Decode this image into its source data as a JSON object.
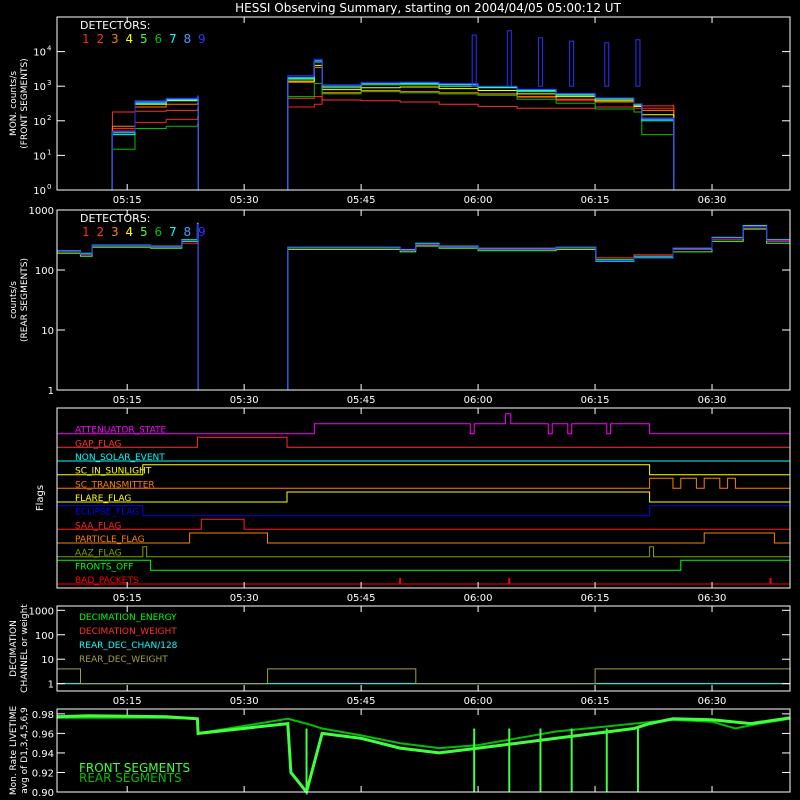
{
  "title": "HESSI Observing Summary, starting on 2004/04/05 05:00:12 UT",
  "colors": {
    "background": "#000000",
    "axes": "#ffffff",
    "det": [
      "#ff2020",
      "#ff3030",
      "#ff7f00",
      "#ffff00",
      "#40ff40",
      "#00c000",
      "#00ffff",
      "#40a0ff",
      "#3030ff"
    ],
    "flags": {
      "attenuator": "#ff00ff",
      "gap": "#ff3030",
      "non_solar": "#00ffff",
      "in_sunlight": "#ffff00",
      "transmitter": "#ff7f00",
      "flare": "#ffff00",
      "eclipse": "#0000ff",
      "saa": "#ff2020",
      "particle": "#ff7f00",
      "aaz": "#80a000",
      "fronts_off": "#00ff00",
      "bad_packets": "#ff0000"
    },
    "dec": [
      "#00ff00",
      "#ff3030",
      "#00ffff",
      "#a0a040"
    ],
    "livetime_front": "#40ff40",
    "livetime_rear": "#00c000"
  },
  "time_axis": {
    "start_min": 6,
    "end_min": 100,
    "ticks": [
      {
        "t": 15,
        "label": "05:15"
      },
      {
        "t": 30,
        "label": "05:30"
      },
      {
        "t": 45,
        "label": "05:45"
      },
      {
        "t": 60,
        "label": "06:00"
      },
      {
        "t": 75,
        "label": "06:15"
      },
      {
        "t": 90,
        "label": "06:30"
      }
    ]
  },
  "chart_data": [
    {
      "type": "line",
      "panel": "front",
      "ylabel": "MON. counts/s (FRONT SEGMENTS)",
      "ylabel_lines": [
        "MON. counts/s",
        "(FRONT SEGMENTS)"
      ],
      "y_scale": "log",
      "ylim": [
        1,
        100000
      ],
      "yticks": [
        {
          "v": 1,
          "base": "10",
          "exp": "0"
        },
        {
          "v": 10,
          "base": "10",
          "exp": "1"
        },
        {
          "v": 100,
          "base": "10",
          "exp": "2"
        },
        {
          "v": 1000,
          "base": "10",
          "exp": "3"
        },
        {
          "v": 10000,
          "base": "10",
          "exp": "4"
        }
      ],
      "legend_title": "DETECTORS:",
      "legend_items": [
        "1",
        "2",
        "3",
        "4",
        "5",
        "6",
        "7",
        "8",
        "9"
      ],
      "x_minutes": [
        6,
        13,
        13.1,
        16,
        20,
        24,
        24.1,
        35.5,
        35.6,
        39,
        40,
        45,
        50,
        55,
        60,
        65,
        70,
        75,
        80,
        81,
        85,
        85.1,
        100
      ],
      "series": [
        {
          "detector": "1",
          "values": [
            1,
            1,
            60,
            90,
            110,
            130,
            1,
            1,
            250,
            300,
            650,
            700,
            650,
            600,
            550,
            480,
            380,
            350,
            230,
            230,
            230,
            1,
            1
          ]
        },
        {
          "detector": "2",
          "values": [
            1,
            1,
            180,
            190,
            200,
            220,
            1,
            1,
            450,
            500,
            400,
            380,
            350,
            300,
            260,
            230,
            230,
            250,
            260,
            270,
            280,
            1,
            1
          ]
        },
        {
          "detector": "3",
          "values": [
            1,
            1,
            70,
            250,
            300,
            320,
            1,
            1,
            1300,
            3500,
            650,
            750,
            700,
            650,
            600,
            500,
            420,
            350,
            260,
            200,
            200,
            1,
            1
          ]
        },
        {
          "detector": "4",
          "values": [
            1,
            1,
            50,
            300,
            380,
            420,
            1,
            1,
            1400,
            4000,
            800,
            900,
            950,
            850,
            750,
            600,
            500,
            380,
            260,
            150,
            150,
            1,
            1
          ]
        },
        {
          "detector": "5",
          "values": [
            1,
            1,
            45,
            350,
            400,
            450,
            1,
            1,
            1600,
            5000,
            900,
            1100,
            1100,
            1000,
            900,
            700,
            550,
            420,
            280,
            120,
            120,
            1,
            1
          ]
        },
        {
          "detector": "6",
          "values": [
            1,
            1,
            15,
            60,
            70,
            80,
            1,
            1,
            500,
            1200,
            600,
            700,
            650,
            600,
            550,
            420,
            320,
            220,
            180,
            40,
            40,
            1,
            1
          ]
        },
        {
          "detector": "7",
          "values": [
            1,
            1,
            40,
            320,
            400,
            500,
            1,
            1,
            1700,
            5000,
            1000,
            1200,
            1200,
            1100,
            950,
            750,
            580,
            440,
            300,
            100,
            100,
            1,
            1
          ]
        },
        {
          "detector": "8",
          "values": [
            1,
            1,
            45,
            350,
            420,
            480,
            1,
            1,
            1800,
            5500,
            1000,
            1200,
            1250,
            1150,
            980,
            800,
            600,
            450,
            300,
            110,
            110,
            1,
            1
          ]
        },
        {
          "detector": "9",
          "values": [
            1,
            1,
            50,
            380,
            450,
            520,
            1,
            1,
            2000,
            6000,
            1100,
            1300,
            1300,
            1200,
            1000,
            820,
            620,
            460,
            310,
            120,
            120,
            1,
            1
          ]
        }
      ],
      "spikes": [
        {
          "t": 59.5,
          "value": 30000
        },
        {
          "t": 64,
          "value": 40000
        },
        {
          "t": 68,
          "value": 25000
        },
        {
          "t": 72,
          "value": 20000
        },
        {
          "t": 76.5,
          "value": 18000
        },
        {
          "t": 80.5,
          "value": 22000
        }
      ]
    },
    {
      "type": "line",
      "panel": "rear",
      "ylabel": "counts/s (REAR SEGMENTS)",
      "ylabel_lines": [
        "counts/s",
        "(REAR SEGMENTS)"
      ],
      "y_scale": "log",
      "ylim": [
        1,
        1000
      ],
      "yticks": [
        {
          "v": 1,
          "label": "1"
        },
        {
          "v": 10,
          "label": "10"
        },
        {
          "v": 100,
          "label": "100"
        },
        {
          "v": 1000,
          "label": "1000"
        }
      ],
      "legend_title": "DETECTORS:",
      "legend_items": [
        "1",
        "2",
        "3",
        "4",
        "5",
        "6",
        "7",
        "8",
        "9"
      ],
      "x_minutes": [
        6,
        9,
        10.5,
        18,
        22,
        24,
        24.1,
        35.5,
        35.6,
        45,
        50,
        52,
        55,
        60,
        70,
        75,
        75.1,
        80,
        85,
        90,
        94,
        97,
        100
      ],
      "series": [
        {
          "detector": "1",
          "values": [
            200,
            180,
            250,
            240,
            280,
            400,
            1,
            1,
            230,
            230,
            210,
            260,
            240,
            220,
            230,
            230,
            160,
            180,
            220,
            320,
            500,
            300,
            200
          ]
        },
        {
          "detector": "5",
          "values": [
            190,
            170,
            240,
            230,
            300,
            500,
            1,
            1,
            220,
            220,
            200,
            250,
            230,
            210,
            220,
            220,
            150,
            170,
            200,
            300,
            480,
            280,
            190
          ]
        },
        {
          "detector": "7",
          "values": [
            210,
            190,
            260,
            250,
            320,
            600,
            1,
            1,
            240,
            240,
            220,
            280,
            250,
            230,
            240,
            240,
            140,
            160,
            230,
            350,
            550,
            320,
            210
          ]
        },
        {
          "detector": "9",
          "values": [
            205,
            185,
            255,
            245,
            310,
            580,
            1,
            1,
            235,
            235,
            215,
            270,
            245,
            225,
            235,
            235,
            145,
            165,
            225,
            340,
            530,
            310,
            205
          ]
        }
      ]
    },
    {
      "type": "line",
      "panel": "flags",
      "ylabel": "Flags",
      "flags": [
        {
          "key": "attenuator",
          "label": "ATTENUATOR_STATE",
          "segments": [
            [
              6,
              0
            ],
            [
              39,
              1
            ],
            [
              59,
              0
            ],
            [
              59.5,
              1
            ],
            [
              63.5,
              2
            ],
            [
              64.2,
              1
            ],
            [
              69,
              0
            ],
            [
              69.5,
              1
            ],
            [
              71.5,
              0
            ],
            [
              72,
              1
            ],
            [
              76.5,
              0
            ],
            [
              77,
              1
            ],
            [
              82,
              0
            ],
            [
              100,
              0
            ]
          ]
        },
        {
          "key": "gap",
          "label": "GAP_FLAG",
          "segments": [
            [
              6,
              0
            ],
            [
              24,
              1
            ],
            [
              35.5,
              0
            ],
            [
              100,
              0
            ]
          ]
        },
        {
          "key": "non_solar",
          "label": "NON_SOLAR_EVENT",
          "segments": [
            [
              6,
              0
            ],
            [
              100,
              0
            ]
          ]
        },
        {
          "key": "in_sunlight",
          "label": "SC_IN_SUNLIGHT",
          "segments": [
            [
              6,
              0
            ],
            [
              17,
              1
            ],
            [
              82,
              0
            ],
            [
              100,
              0
            ]
          ]
        },
        {
          "key": "transmitter",
          "label": "SC_TRANSMITTER",
          "segments": [
            [
              6,
              0
            ],
            [
              82,
              1
            ],
            [
              85,
              0
            ],
            [
              86,
              1
            ],
            [
              88,
              0
            ],
            [
              89,
              1
            ],
            [
              91,
              0
            ],
            [
              92,
              1
            ],
            [
              93,
              0
            ],
            [
              100,
              0
            ]
          ]
        },
        {
          "key": "flare",
          "label": "FLARE_FLAG",
          "segments": [
            [
              6,
              0
            ],
            [
              35.5,
              1
            ],
            [
              82,
              0
            ],
            [
              100,
              0
            ]
          ]
        },
        {
          "key": "eclipse",
          "label": "ECLIPSE_FLAG",
          "segments": [
            [
              6,
              1
            ],
            [
              17,
              0
            ],
            [
              82,
              1
            ],
            [
              100,
              1
            ]
          ]
        },
        {
          "key": "saa",
          "label": "SAA_FLAG",
          "segments": [
            [
              6,
              0
            ],
            [
              24.5,
              1
            ],
            [
              30,
              0
            ],
            [
              100,
              0
            ]
          ]
        },
        {
          "key": "particle",
          "label": "PARTICLE_FLAG",
          "segments": [
            [
              6,
              0
            ],
            [
              23,
              1
            ],
            [
              33,
              0
            ],
            [
              89,
              1
            ],
            [
              98,
              0
            ],
            [
              100,
              0
            ]
          ]
        },
        {
          "key": "aaz",
          "label": "AAZ_FLAG",
          "segments": [
            [
              6,
              0
            ],
            [
              17,
              1
            ],
            [
              17.5,
              0
            ],
            [
              82,
              1
            ],
            [
              82.5,
              0
            ],
            [
              100,
              0
            ]
          ]
        },
        {
          "key": "fronts_off",
          "label": "FRONTS_OFF",
          "segments": [
            [
              6,
              1
            ],
            [
              18,
              0
            ],
            [
              86,
              1
            ],
            [
              100,
              1
            ]
          ]
        },
        {
          "key": "bad_packets",
          "label": "BAD_PACKETS",
          "spikes": [
            50,
            64,
            97.5
          ]
        }
      ]
    },
    {
      "type": "line",
      "panel": "decimation",
      "ylabel": "DECIMATION CHANNEL or weight",
      "ylabel_lines": [
        "DECIMATION",
        "CHANNEL or weight"
      ],
      "y_scale": "log",
      "ylim": [
        0.5,
        1500
      ],
      "yticks": [
        {
          "v": 1,
          "label": "1"
        },
        {
          "v": 10,
          "label": "10"
        },
        {
          "v": 100,
          "label": "100"
        },
        {
          "v": 1000,
          "label": "1000"
        }
      ],
      "series": [
        {
          "name": "DECIMATION_ENERGY",
          "x": [
            6,
            100
          ],
          "values": [
            1,
            1
          ]
        },
        {
          "name": "DECIMATION_WEIGHT",
          "x": [
            6,
            100
          ],
          "values": [
            1,
            1
          ]
        },
        {
          "name": "REAR_DEC_CHAN/128",
          "x": [
            6,
            100
          ],
          "values": [
            1,
            1
          ]
        },
        {
          "name": "REAR_DEC_WEIGHT",
          "x": [
            6,
            9,
            9.01,
            33,
            33.01,
            52,
            52.01,
            75,
            75.01,
            100
          ],
          "values": [
            4,
            4,
            1,
            1,
            4,
            4,
            1,
            1,
            4,
            4
          ]
        }
      ]
    },
    {
      "type": "line",
      "panel": "livetime",
      "ylabel": "Mon. Rate LIVETIME avg of D1,3,4,5,6,9",
      "ylabel_lines": [
        "Mon. Rate LIVETIME",
        "avg of D1,3,4,5,6,9"
      ],
      "ylim": [
        0.9,
        0.985
      ],
      "yticks": [
        {
          "v": 0.9,
          "label": "0.90"
        },
        {
          "v": 0.92,
          "label": "0.92"
        },
        {
          "v": 0.94,
          "label": "0.94"
        },
        {
          "v": 0.96,
          "label": "0.96"
        },
        {
          "v": 0.98,
          "label": "0.98"
        }
      ],
      "legend_items": [
        "FRONT SEGMENTS",
        "REAR SEGMENTS"
      ],
      "series": [
        {
          "name": "FRONT SEGMENTS",
          "x": [
            6,
            10,
            20,
            24,
            24.1,
            35.6,
            36,
            37,
            38,
            40,
            45,
            50,
            55,
            60,
            65,
            70,
            75,
            80,
            82,
            85,
            90,
            95,
            100
          ],
          "values": [
            0.977,
            0.978,
            0.977,
            0.975,
            0.96,
            0.97,
            0.92,
            0.91,
            0.9,
            0.96,
            0.955,
            0.945,
            0.94,
            0.945,
            0.95,
            0.955,
            0.96,
            0.965,
            0.97,
            0.975,
            0.974,
            0.97,
            0.976
          ]
        },
        {
          "name": "REAR SEGMENTS",
          "x": [
            6,
            20,
            24,
            24.1,
            35.6,
            38,
            40,
            45,
            50,
            55,
            60,
            65,
            70,
            75,
            80,
            85,
            90,
            93,
            96,
            100
          ],
          "values": [
            0.976,
            0.976,
            0.975,
            0.96,
            0.975,
            0.97,
            0.965,
            0.958,
            0.95,
            0.945,
            0.948,
            0.955,
            0.962,
            0.966,
            0.97,
            0.974,
            0.972,
            0.965,
            0.97,
            0.975
          ]
        }
      ],
      "dropouts": [
        38,
        59.5,
        64,
        68,
        72,
        76.5,
        80.5
      ]
    }
  ]
}
